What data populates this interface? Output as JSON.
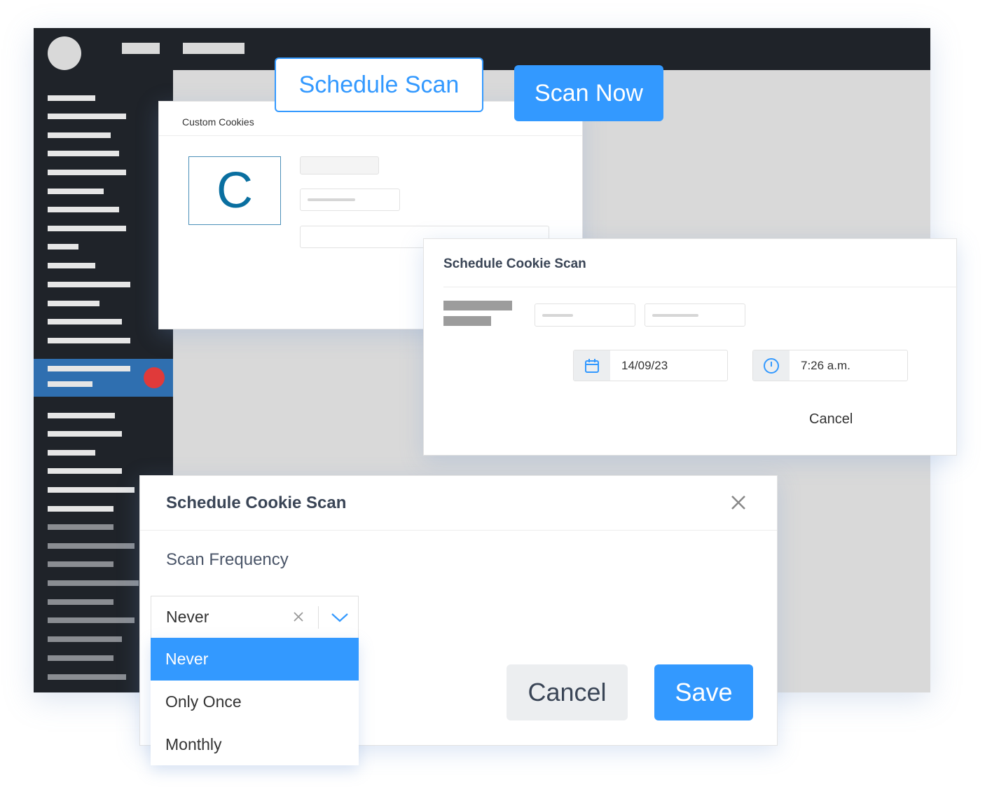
{
  "toolbar": {
    "schedule_scan_label": "Schedule Scan",
    "scan_now_label": "Scan Now"
  },
  "custom_cookies": {
    "title": "Custom Cookies",
    "logo_letter": "C"
  },
  "schedule_panel": {
    "title": "Schedule Cookie Scan",
    "date_value": "14/09/23",
    "time_value": "7:26 a.m.",
    "cancel_label": "Cancel",
    "icons": [
      "calendar-icon",
      "clock-icon"
    ]
  },
  "schedule_dialog": {
    "title": "Schedule Cookie Scan",
    "frequency_label": "Scan Frequency",
    "selected": "Never",
    "options": [
      "Never",
      "Only Once",
      "Monthly"
    ],
    "cancel_label": "Cancel",
    "save_label": "Save",
    "icons": [
      "close-icon",
      "clear-icon",
      "chevron-down-icon"
    ]
  },
  "colors": {
    "accent": "#3399ff",
    "dark": "#1f2329",
    "badge": "#e03a3a",
    "logo": "#0a6fa0"
  }
}
